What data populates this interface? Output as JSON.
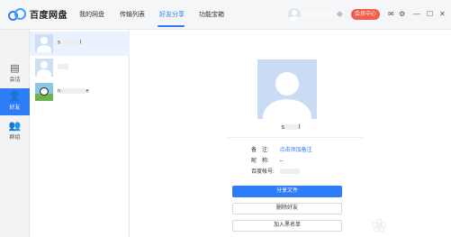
{
  "app": {
    "name": "百度网盘"
  },
  "nav": {
    "items": [
      {
        "label": "我的网盘"
      },
      {
        "label": "传输列表"
      },
      {
        "label": "好友分享",
        "active": true
      },
      {
        "label": "功能宝箱"
      }
    ]
  },
  "topbar": {
    "vip_label": "会员中心",
    "icons": [
      "user-avatar-icon",
      "vip-diamond-icon",
      "mail-icon",
      "settings-icon",
      "minimize-icon",
      "maximize-icon",
      "close-icon"
    ]
  },
  "rail": {
    "items": [
      {
        "label": "会话",
        "icon": "chat-icon"
      },
      {
        "label": "好友",
        "icon": "friend-icon",
        "active": true
      },
      {
        "label": "群组",
        "icon": "group-icon"
      }
    ]
  },
  "friends": [
    {
      "name_visible": "s",
      "name_tail": "l"
    },
    {
      "name_visible": "",
      "name_tail": ""
    },
    {
      "name_visible": "n",
      "name_tail": "e"
    }
  ],
  "detail": {
    "name_visible": "s",
    "name_tail": "l",
    "remark_label": "备　注:",
    "remark_value": "点击添加备注",
    "nickname_label": "昵　称:",
    "nickname_value": "--",
    "account_label": "百度帐号:",
    "buttons": {
      "share": "分享文件",
      "delete": "删除好友",
      "blacklist": "加入黑名单"
    }
  },
  "colors": {
    "accent": "#2e7cf6",
    "vip": "#f25d4d",
    "selected_row": "#eaf2ff"
  }
}
